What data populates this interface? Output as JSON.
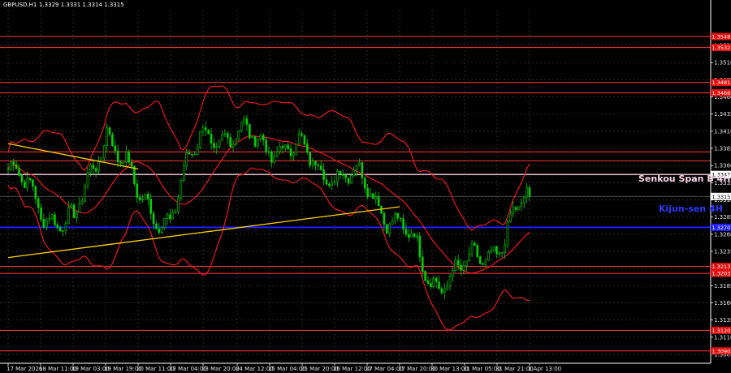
{
  "header": {
    "symbol": "GBPUSD,H1",
    "ohlc": "1.3329 1.3331 1.3314 1.3315"
  },
  "colors": {
    "background": "#000000",
    "grid": "#3a3a3a",
    "candle": "#00d000",
    "bollinger": "#ff1a1a",
    "red_level": "#ff3b3b",
    "trendline": "#ffd000",
    "senkou": "#ffd6e8",
    "kijun": "#1e1eff",
    "axis": "#ffffff"
  },
  "annotations": {
    "senkou_label": "Senkou Span B 4H",
    "kijun_label": "Kijun-sen 4H"
  },
  "chart_data": {
    "type": "candlestick",
    "symbol": "GBPUSD",
    "timeframe": "H1",
    "ylim": [
      1.3072,
      1.3587
    ],
    "grid": true,
    "y_ticks": [
      "1.3085",
      "1.3110",
      "1.3135",
      "1.3160",
      "1.3185",
      "1.3210",
      "1.3235",
      "1.3260",
      "1.3285",
      "1.3310",
      "1.3335",
      "1.3360",
      "1.3385",
      "1.3410",
      "1.3435",
      "1.3460",
      "1.3485",
      "1.3510",
      "1.3535"
    ],
    "x_ticks": [
      "17 Mar 2026",
      "18 Mar 11:00",
      "19 Mar 03:00",
      "19 Mar 19:00",
      "20 Mar 11:00",
      "23 Mar 04:00",
      "23 Mar 20:00",
      "24 Mar 12:00",
      "25 Mar 04:00",
      "25 Mar 20:00",
      "26 Mar 12:00",
      "27 Mar 04:00",
      "27 Mar 20:00",
      "30 Mar 13:00",
      "31 Mar 05:00",
      "31 Mar 21:00",
      "1 Apr 13:00"
    ],
    "current_price": "1.3315",
    "price_tags": [
      {
        "value": "1.3548",
        "color": "red"
      },
      {
        "value": "1.3532",
        "color": "red"
      },
      {
        "value": "1.3481",
        "color": "red"
      },
      {
        "value": "1.3466",
        "color": "red"
      },
      {
        "value": "1.3347",
        "color": "white"
      },
      {
        "value": "1.3315",
        "color": "white"
      },
      {
        "value": "1.3270",
        "color": "blue"
      },
      {
        "value": "1.3213",
        "color": "red"
      },
      {
        "value": "1.3203",
        "color": "red"
      },
      {
        "value": "1.3120",
        "color": "red"
      },
      {
        "value": "1.3090",
        "color": "red"
      }
    ],
    "horizontal_levels": [
      {
        "value": 1.3548,
        "kind": "resistance"
      },
      {
        "value": 1.3532,
        "kind": "resistance"
      },
      {
        "value": 1.3481,
        "kind": "resistance"
      },
      {
        "value": 1.3466,
        "kind": "resistance"
      },
      {
        "value": 1.338,
        "kind": "resistance"
      },
      {
        "value": 1.3367,
        "kind": "resistance"
      },
      {
        "value": 1.3347,
        "kind": "senkou_span_b_4h"
      },
      {
        "value": 1.3315,
        "kind": "current_price"
      },
      {
        "value": 1.327,
        "kind": "kijun_sen_4h"
      },
      {
        "value": 1.3213,
        "kind": "support"
      },
      {
        "value": 1.3203,
        "kind": "support"
      },
      {
        "value": 1.312,
        "kind": "support"
      },
      {
        "value": 1.309,
        "kind": "support"
      }
    ],
    "trendlines": [
      {
        "start": {
          "x": "17 Mar 2026",
          "y": 1.3392
        },
        "end": {
          "x": "20 Mar 11:00",
          "y": 1.3355
        }
      },
      {
        "start": {
          "x": "17 Mar 2026",
          "y": 1.3226
        },
        "end": {
          "x": "27 Mar 20:00",
          "y": 1.33
        }
      }
    ],
    "close_path": [
      {
        "x": "17 Mar 2026",
        "y": 1.3355
      },
      {
        "x": "18 Mar 11:00",
        "y": 1.33
      },
      {
        "x": "19 Mar 03:00",
        "y": 1.327
      },
      {
        "x": "19 Mar 19:00",
        "y": 1.342
      },
      {
        "x": "20 Mar 11:00",
        "y": 1.3305
      },
      {
        "x": "23 Mar 04:00",
        "y": 1.3285
      },
      {
        "x": "23 Mar 20:00",
        "y": 1.341
      },
      {
        "x": "24 Mar 12:00",
        "y": 1.34
      },
      {
        "x": "25 Mar 04:00",
        "y": 1.3395
      },
      {
        "x": "25 Mar 20:00",
        "y": 1.3375
      },
      {
        "x": "26 Mar 12:00",
        "y": 1.335
      },
      {
        "x": "27 Mar 04:00",
        "y": 1.333
      },
      {
        "x": "27 Mar 20:00",
        "y": 1.327
      },
      {
        "x": "30 Mar 13:00",
        "y": 1.3195
      },
      {
        "x": "31 Mar 05:00",
        "y": 1.3205
      },
      {
        "x": "31 Mar 21:00",
        "y": 1.3245
      },
      {
        "x": "1 Apr 13:00",
        "y": 1.3315
      }
    ]
  }
}
